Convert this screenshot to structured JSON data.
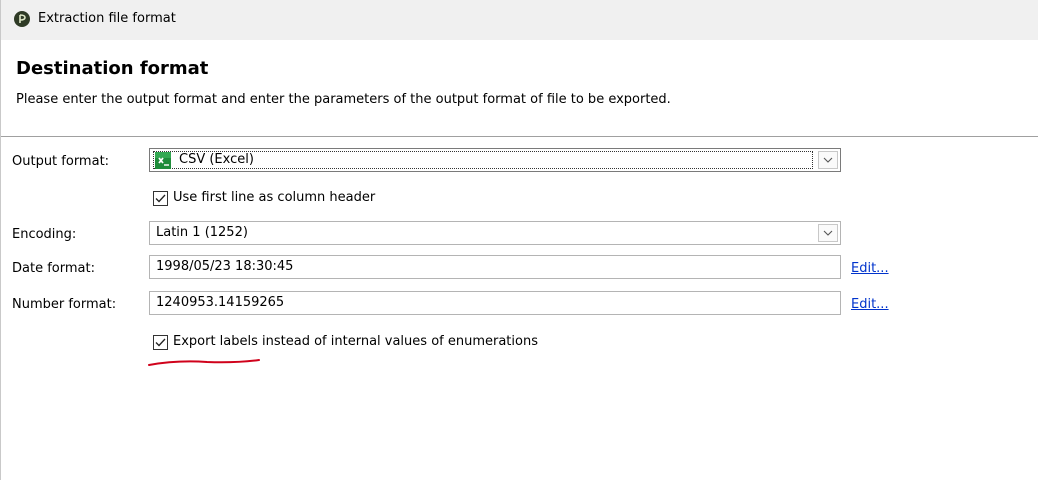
{
  "window": {
    "title": "Extraction file format"
  },
  "header": {
    "title": "Destination format",
    "description": "Please enter the output format and enter the parameters of the output format of file to be exported."
  },
  "form": {
    "output_format": {
      "label": "Output format:",
      "value": "CSV (Excel)",
      "icon": "excel-csv-icon"
    },
    "use_first_line": {
      "label": "Use first line as column header",
      "checked": true
    },
    "encoding": {
      "label": "Encoding:",
      "value": "Latin 1 (1252)"
    },
    "date_format": {
      "label": "Date format:",
      "value": "1998/05/23 18:30:45",
      "edit_label": "Edit..."
    },
    "number_format": {
      "label": "Number format:",
      "value": "1240953.14159265",
      "edit_label": "Edit..."
    },
    "export_labels": {
      "label": "Export labels instead of internal values of enumerations",
      "checked": true
    }
  },
  "colors": {
    "link": "#0033cc",
    "annotation": "#d0021b",
    "excel_green": "#1f8c3b"
  }
}
